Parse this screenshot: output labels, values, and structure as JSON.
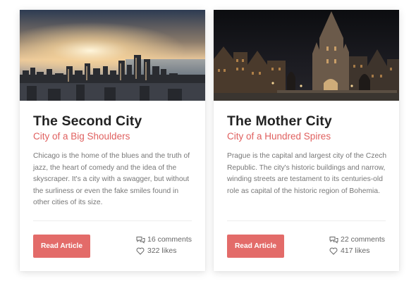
{
  "cards": [
    {
      "title": "The Second City",
      "subtitle": "City of a Big Shoulders",
      "description": "Chicago is the home of the blues and the truth of jazz, the heart of comedy and the idea of the skyscraper. It's a city with a swagger, but without the surliness or even the fake smiles found in other cities of its size.",
      "button_label": "Read Article",
      "comments": "16 comments",
      "likes": "322 likes",
      "image": "chicago-skyline-sunset-photo"
    },
    {
      "title": "The Mother City",
      "subtitle": "City of a Hundred Spires",
      "description": "Prague is the capital and largest city of the Czech Republic. The city's historic buildings and narrow, winding streets are testament to its centuries-old role as capital of the historic region of Bohemia.",
      "button_label": "Read Article",
      "comments": "22 comments",
      "likes": "417 likes",
      "image": "prague-charles-bridge-night-photo"
    }
  ],
  "icons": {
    "comments": "speech-bubbles-icon",
    "likes": "heart-outline-icon"
  },
  "colors": {
    "accent": "#e36b69",
    "subtitle": "#e0605f",
    "title": "#222222",
    "body_text": "#777777"
  }
}
